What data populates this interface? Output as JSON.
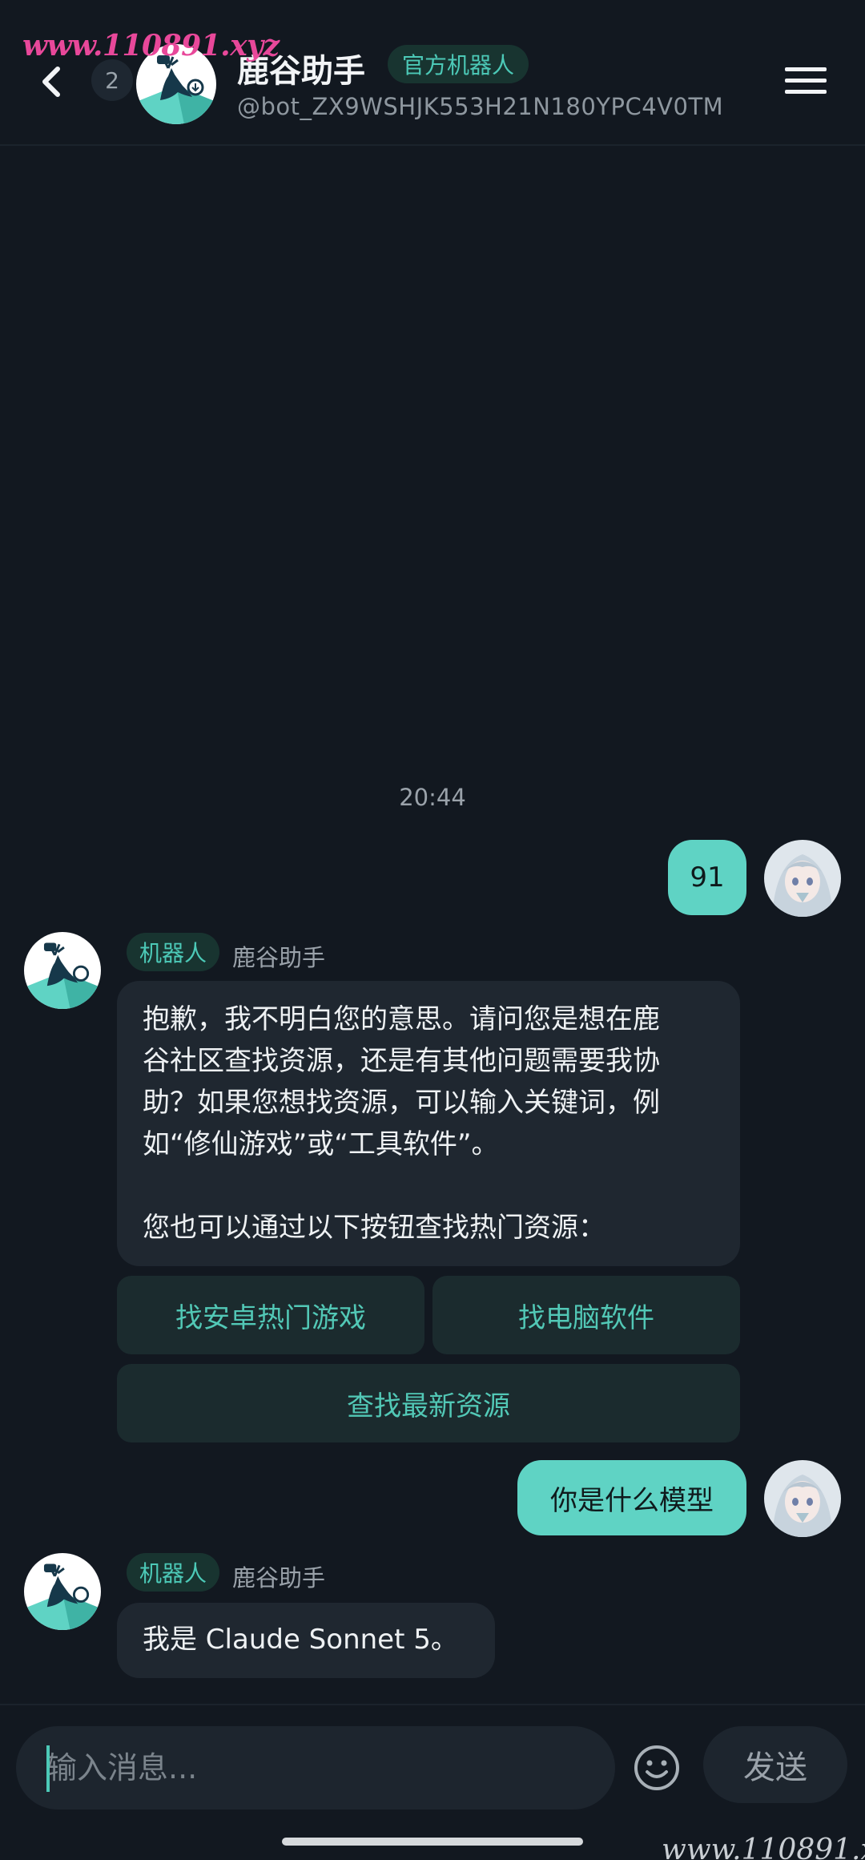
{
  "watermark": "www.110891.xyz",
  "header": {
    "back_icon": "chevron-left-icon",
    "unread_count": "2",
    "title": "鹿谷助手",
    "official_tag": "官方机器人",
    "handle": "@bot_ZX9WSHJK553H21N180YPC4V0TM",
    "menu_icon": "hamburger-menu-icon"
  },
  "messages": {
    "timestamp": "20:44",
    "user_1": "91",
    "bot_1": {
      "tag": "机器人",
      "name": "鹿谷助手",
      "line_1": "抱歉，我不明白您的意思。请问您是想在鹿",
      "line_2": "谷社区查找资源，还是有其他问题需要我协",
      "line_3": "助？如果您想找资源，可以输入关键词，例",
      "line_4": "如“修仙游戏”或“工具软件”。",
      "line_5": "您也可以通过以下按钮查找热门资源："
    },
    "quick_replies": {
      "android_games": "找安卓热门游戏",
      "pc_software": "找电脑软件",
      "latest": "查找最新资源"
    },
    "user_2": "你是什么模型",
    "bot_2": {
      "tag": "机器人",
      "name": "鹿谷助手",
      "text": "我是 Claude Sonnet 5。"
    }
  },
  "composer": {
    "placeholder": "输入消息...",
    "emoji_icon": "smiley-icon",
    "send_label": "发送"
  },
  "colors": {
    "background": "#121820",
    "accent": "#5fd3c4",
    "bot_bubble": "#1f2730",
    "tag_bg": "#183430",
    "tag_text": "#4cc9b7"
  }
}
